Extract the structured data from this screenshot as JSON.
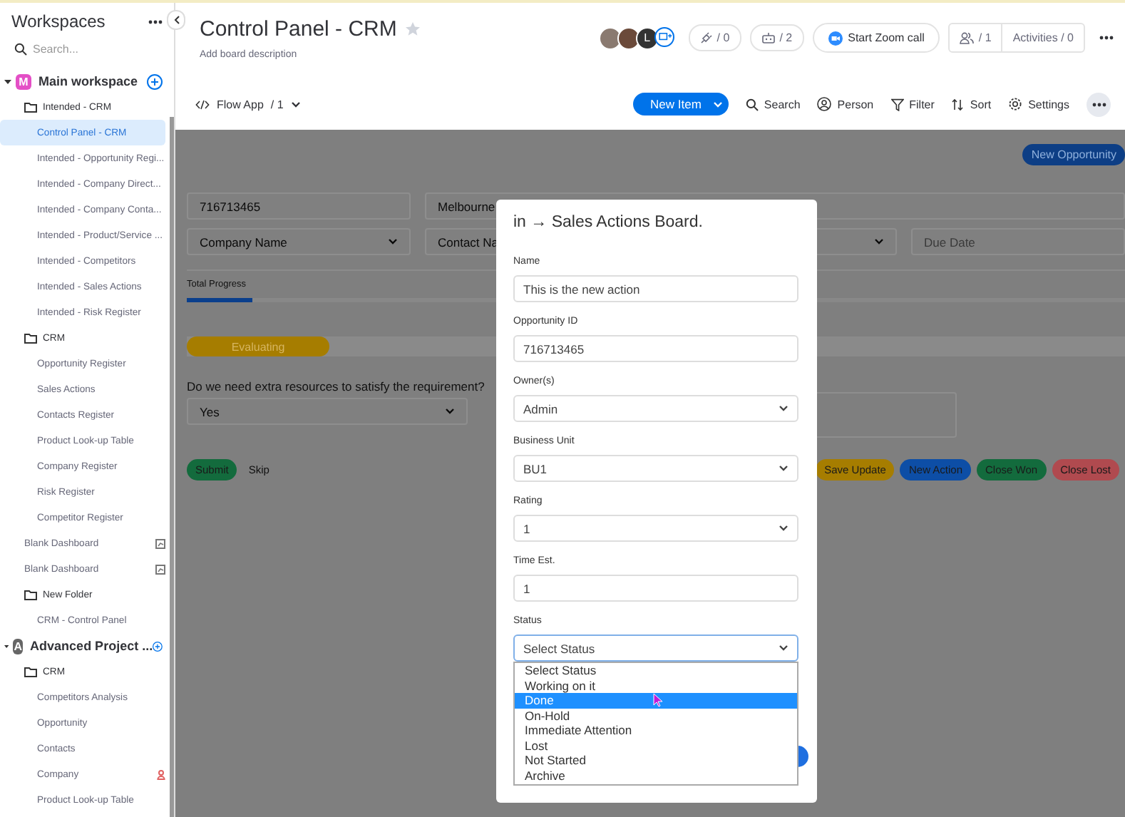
{
  "sidebar": {
    "title": "Workspaces",
    "search": {
      "placeholder": "Search..."
    },
    "workspaces": [
      {
        "letter": "M",
        "name": "Main workspace",
        "color": "#e44fc6",
        "expanded": true,
        "children": [
          {
            "kind": "folder",
            "label": "Intended - CRM",
            "selected": false,
            "children": [
              {
                "kind": "board",
                "label": "Control Panel - CRM",
                "selected": true,
                "alert": false
              },
              {
                "kind": "board",
                "label": "Intended - Opportunity Regi...",
                "selected": false,
                "alert": false
              },
              {
                "kind": "board",
                "label": "Intended - Company Direct...",
                "selected": false,
                "alert": false
              },
              {
                "kind": "board",
                "label": "Intended - Company Conta...",
                "selected": false,
                "alert": false
              },
              {
                "kind": "board",
                "label": "Intended - Product/Service ...",
                "selected": false,
                "alert": false
              },
              {
                "kind": "board",
                "label": "Intended - Competitors",
                "selected": false,
                "alert": false
              },
              {
                "kind": "board",
                "label": "Intended - Sales Actions",
                "selected": false,
                "alert": false
              },
              {
                "kind": "board",
                "label": "Intended - Risk Register",
                "selected": false,
                "alert": false
              }
            ]
          },
          {
            "kind": "folder",
            "label": "CRM",
            "selected": false,
            "children": [
              {
                "kind": "board",
                "label": "Opportunity Register",
                "selected": false,
                "alert": false
              },
              {
                "kind": "board",
                "label": "Sales Actions",
                "selected": false,
                "alert": false
              },
              {
                "kind": "board",
                "label": "Contacts Register",
                "selected": false,
                "alert": false
              },
              {
                "kind": "board",
                "label": "Product Look-up Table",
                "selected": false,
                "alert": false
              },
              {
                "kind": "board",
                "label": "Company Register",
                "selected": false,
                "alert": false
              },
              {
                "kind": "board",
                "label": "Risk Register",
                "selected": false,
                "alert": false
              },
              {
                "kind": "board",
                "label": "Competitor Register",
                "selected": false,
                "alert": false
              }
            ]
          },
          {
            "kind": "dashboard",
            "label": "Blank Dashboard",
            "selected": false
          },
          {
            "kind": "dashboard",
            "label": "Blank Dashboard",
            "selected": false
          },
          {
            "kind": "folder",
            "label": "New Folder",
            "selected": false,
            "children": [
              {
                "kind": "board",
                "label": "CRM - Control Panel",
                "selected": false,
                "alert": false
              }
            ]
          }
        ]
      },
      {
        "letter": "A",
        "name": "Advanced Project ...",
        "color": "#666666",
        "expanded": true,
        "children": [
          {
            "kind": "folder",
            "label": "CRM",
            "selected": false,
            "children": [
              {
                "kind": "board",
                "label": "Competitors Analysis",
                "selected": false,
                "alert": false
              },
              {
                "kind": "board",
                "label": "Opportunity",
                "selected": false,
                "alert": false
              },
              {
                "kind": "board",
                "label": "Contacts",
                "selected": false,
                "alert": false
              },
              {
                "kind": "board",
                "label": "Company",
                "selected": false,
                "alert": true
              },
              {
                "kind": "board",
                "label": "Product Look-up Table",
                "selected": false,
                "alert": false
              }
            ]
          }
        ]
      }
    ]
  },
  "board": {
    "title": "Control Panel - CRM",
    "starred": false,
    "description": "Add board description"
  },
  "header_tools": {
    "avatars": [
      {
        "kind": "photo"
      },
      {
        "kind": "photo"
      },
      {
        "kind": "letter",
        "letter": "L"
      },
      {
        "kind": "invite"
      }
    ],
    "counters": [
      {
        "kind": "integrations",
        "text": "/ 0"
      },
      {
        "kind": "automations",
        "text": "/ 2"
      }
    ],
    "zoom_call": "Start Zoom call",
    "members": "/ 1",
    "activities": "Activities / 0"
  },
  "toolbar": {
    "view": {
      "label": "Flow App",
      "count": "/ 1"
    },
    "new_item": "New Item",
    "actions": [
      {
        "kind": "search",
        "label": "Search"
      },
      {
        "kind": "person",
        "label": "Person"
      },
      {
        "kind": "filter",
        "label": "Filter"
      },
      {
        "kind": "sort",
        "label": "Sort"
      },
      {
        "kind": "settings",
        "label": "Settings"
      }
    ]
  },
  "form": {
    "new_opportunity": "New Opportunity",
    "row_1": [
      {
        "kind": "input",
        "value": "716713465"
      },
      {
        "kind": "input",
        "value": "Melbourne"
      }
    ],
    "row_2": [
      {
        "kind": "select",
        "value": "Company Name"
      },
      {
        "kind": "select",
        "value": "Contact Na"
      },
      {
        "kind": "select"
      },
      {
        "kind": "input",
        "placeholder": "Due Date"
      }
    ],
    "progress": {
      "label": "Total Progress",
      "level": 0.07
    },
    "stage": {
      "label": "Evaluating"
    },
    "question": {
      "label": "Do we need extra resources to satisfy the requirement?",
      "value": "Yes"
    },
    "left_buttons": [
      {
        "kind": "pill",
        "label": "Submit",
        "color": "#136b3d"
      },
      {
        "kind": "link",
        "label": "Skip"
      }
    ],
    "right_buttons": [
      {
        "label": "Save Update",
        "color": "#a67d00"
      },
      {
        "label": "New Action",
        "color": "#0d4ea6"
      },
      {
        "label": "Close Won",
        "color": "#136b3d"
      },
      {
        "label": "Close Lost",
        "color": "#b04a4f"
      }
    ]
  },
  "modal": {
    "title": "in → Sales Actions Board.",
    "fields": [
      {
        "kind": "input",
        "label": "Name",
        "value": "This is the new action"
      },
      {
        "kind": "input",
        "label": "Opportunity ID",
        "value": "716713465"
      },
      {
        "kind": "select",
        "label": "Owner(s)",
        "value": "Admin"
      },
      {
        "kind": "select",
        "label": "Business Unit",
        "value": "BU1"
      },
      {
        "kind": "select",
        "label": "Rating",
        "value": "1"
      },
      {
        "kind": "input",
        "label": "Time Est.",
        "value": "1"
      },
      {
        "kind": "select",
        "label": "Status",
        "value": "Select Status",
        "expanded": true,
        "options": [
          {
            "label": "Select Status",
            "highlighted": false
          },
          {
            "label": "Working on it",
            "highlighted": false
          },
          {
            "label": "Done",
            "highlighted": true
          },
          {
            "label": "On-Hold",
            "highlighted": false
          },
          {
            "label": "Immediate Attention",
            "highlighted": false
          },
          {
            "label": "Lost",
            "highlighted": false
          },
          {
            "label": "Not Started",
            "highlighted": false
          },
          {
            "label": "Archive",
            "highlighted": false
          }
        ]
      }
    ]
  }
}
